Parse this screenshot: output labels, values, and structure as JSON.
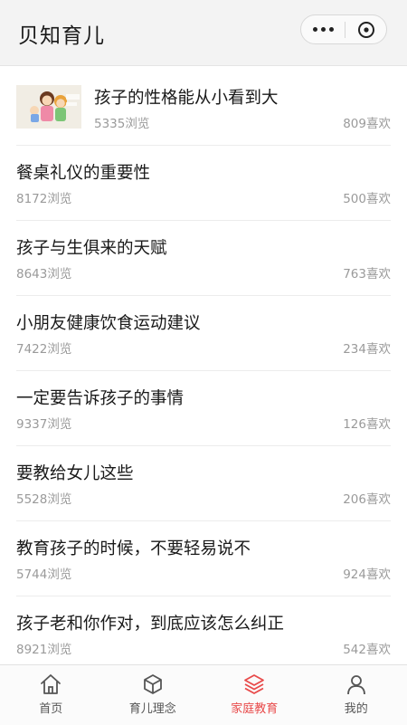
{
  "app": {
    "title": "贝知育儿"
  },
  "articles": [
    {
      "title": "孩子的性格能从小看到大",
      "views": "5335浏览",
      "likes": "809喜欢"
    },
    {
      "title": "餐桌礼仪的重要性",
      "views": "8172浏览",
      "likes": "500喜欢"
    },
    {
      "title": "孩子与生俱来的天赋",
      "views": "8643浏览",
      "likes": "763喜欢"
    },
    {
      "title": "小朋友健康饮食运动建议",
      "views": "7422浏览",
      "likes": "234喜欢"
    },
    {
      "title": "一定要告诉孩子的事情",
      "views": "9337浏览",
      "likes": "126喜欢"
    },
    {
      "title": "要教给女儿这些",
      "views": "5528浏览",
      "likes": "206喜欢"
    },
    {
      "title": "教育孩子的时候，不要轻易说不",
      "views": "5744浏览",
      "likes": "924喜欢"
    },
    {
      "title": "孩子老和你作对，到底应该怎么纠正",
      "views": "8921浏览",
      "likes": "542喜欢"
    }
  ],
  "tabs": [
    {
      "label": "首页",
      "icon": "home-icon"
    },
    {
      "label": "育儿理念",
      "icon": "cube-icon"
    },
    {
      "label": "家庭教育",
      "icon": "layers-icon",
      "active": true
    },
    {
      "label": "我的",
      "icon": "user-icon"
    }
  ],
  "colors": {
    "accent": "#e84a4a",
    "muted_text": "#9a9a9a",
    "header_bg": "#f3f3f3"
  }
}
